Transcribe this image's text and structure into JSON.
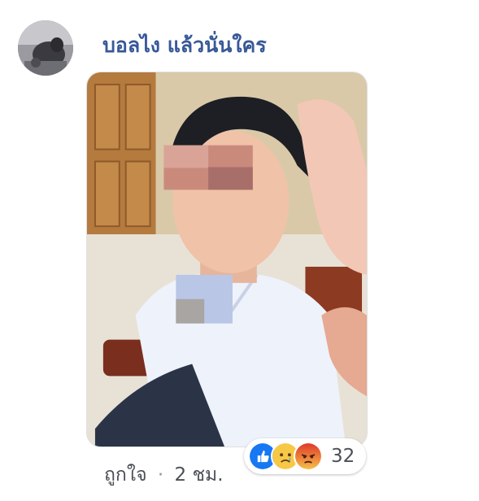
{
  "comment": {
    "author": "บอลไง แล้วนั่นใคร",
    "like_link": "ถูกใจ",
    "separator": "·",
    "time": "2 ชม.",
    "reactions": {
      "icons": [
        "like-icon",
        "sad-icon",
        "angry-icon"
      ],
      "count": "32"
    }
  },
  "colors": {
    "author_name": "#385898",
    "like_blue": "#1877f2",
    "sad_yellow": "#f7c846",
    "angry_red": "#e9710f"
  }
}
